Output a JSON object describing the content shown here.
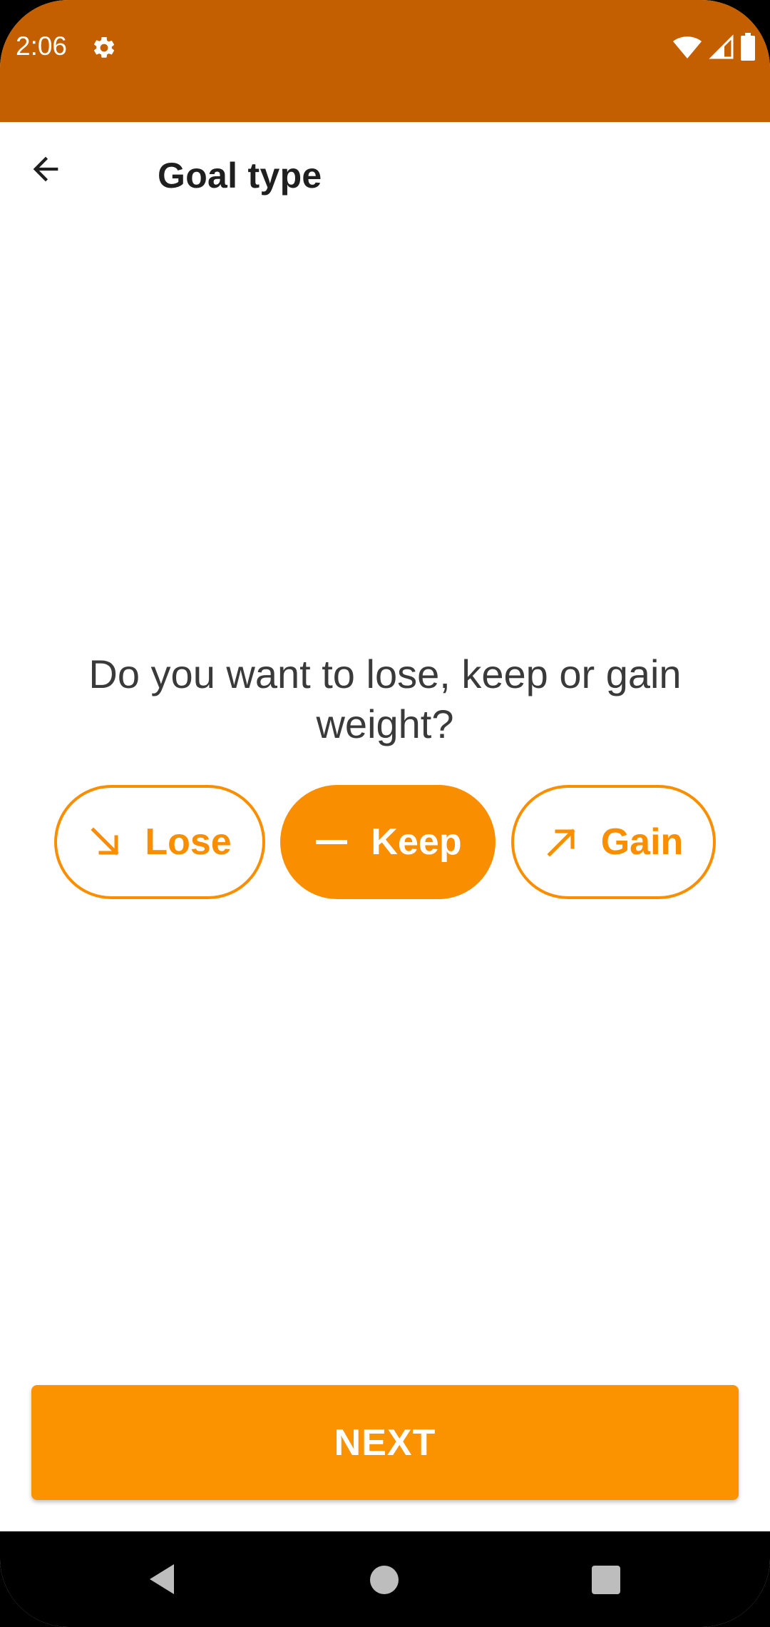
{
  "status_bar": {
    "time": "2:06",
    "icons": [
      "gear-icon",
      "wifi-icon",
      "signal-icon",
      "battery-icon"
    ],
    "background_color": "#C45F00"
  },
  "app_bar": {
    "back_icon": "arrow-back-icon",
    "title": "Goal type"
  },
  "main": {
    "question": "Do you want to lose, keep or gain weight?",
    "options": [
      {
        "label": "Lose",
        "icon": "arrow-down-right-icon",
        "selected": false
      },
      {
        "label": "Keep",
        "icon": "dash-icon",
        "selected": true
      },
      {
        "label": "Gain",
        "icon": "arrow-up-right-icon",
        "selected": false
      }
    ],
    "accent_color": "#F98E00"
  },
  "footer": {
    "next_label": "NEXT",
    "button_color": "#FB9200"
  },
  "nav_bar": {
    "icons": [
      "nav-back-icon",
      "nav-home-icon",
      "nav-recents-icon"
    ]
  }
}
